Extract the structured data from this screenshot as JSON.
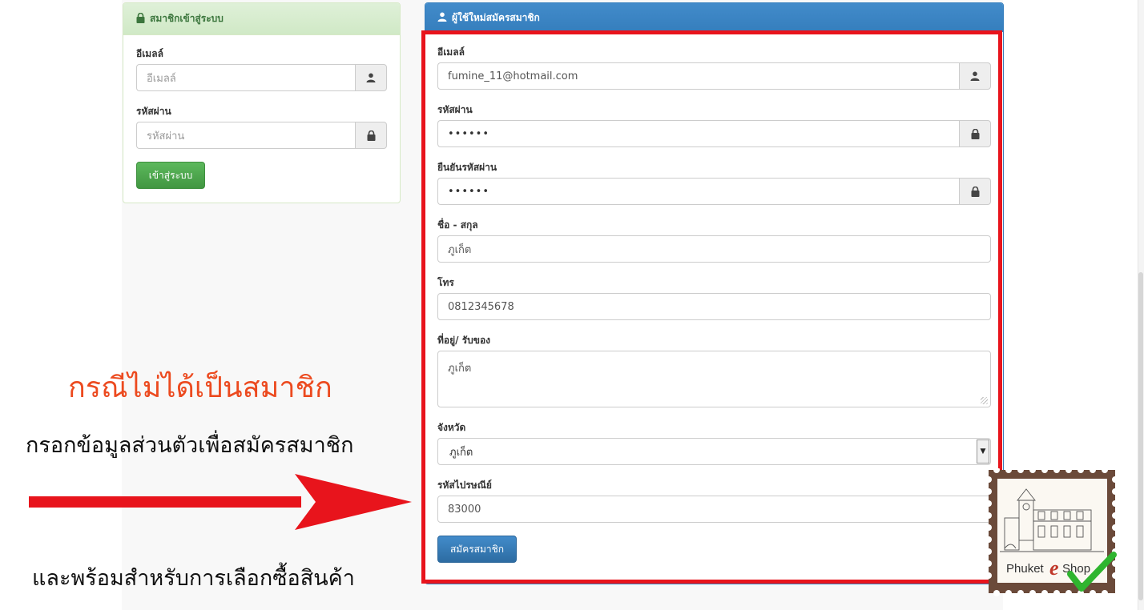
{
  "login": {
    "title": "สมาชิกเข้าสู่ระบบ",
    "email_label": "อีเมลล์",
    "email_placeholder": "อีเมลล์",
    "password_label": "รหัสผ่าน",
    "password_placeholder": "รหัสผ่าน",
    "submit_label": "เข้าสู่ระบบ"
  },
  "register": {
    "title": "ผู้ใช้ใหม่สมัครสมาชิก",
    "email_label": "อีเมลล์",
    "email_value": "fumine_11@hotmail.com",
    "password_label": "รหัสผ่าน",
    "password_value": "••••••",
    "confirm_label": "ยืนยันรหัสผ่าน",
    "confirm_value": "••••••",
    "name_label": "ชื่อ - สกุล",
    "name_value": "ภูเก็ต",
    "phone_label": "โทร",
    "phone_value": "0812345678",
    "address_label": "ที่อยู่/ รับของ",
    "address_value": "ภูเก็ต",
    "province_label": "จังหวัด",
    "province_value": "ภูเก็ต",
    "postcode_label": "รหัสไปรษณีย์",
    "postcode_value": "83000",
    "submit_label": "สมัครสมาชิก"
  },
  "annotation": {
    "title": "กรณีไม่ได้เป็นสมาชิก",
    "line2": "กรอกข้อมูลส่วนตัวเพื่อสมัครสมาชิก",
    "line3": "และพร้อมสำหรับการเลือกซื้อสินค้า"
  },
  "logo": {
    "text_a": "Phuket",
    "text_b": "e",
    "text_c": "Shop"
  },
  "colors": {
    "highlight_red": "#e8141c",
    "annotation_orange": "#ec4a1f",
    "panel_blue": "#428bca",
    "panel_green": "#dff0d8",
    "check_green": "#2fb52f"
  }
}
